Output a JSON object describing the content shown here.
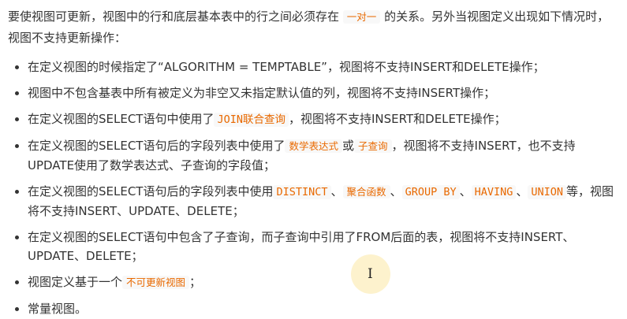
{
  "intro": {
    "text1": "要使视图可更新，视图中的行和底层基本表中的行之间必须存在",
    "code1": "一对一",
    "text2": "的关系。另外当视图定义出现如下情况时，视图不支持更新操作："
  },
  "items": [
    {
      "parts": [
        {
          "t": "在定义视图的时候指定了“ALGORITHM = TEMPTABLE”，视图将不支持INSERT和DELETE操作；"
        }
      ]
    },
    {
      "parts": [
        {
          "t": "视图中不包含基表中所有被定义为非空又未指定默认值的列，视图将不支持INSERT操作；"
        }
      ]
    },
    {
      "parts": [
        {
          "t": "在定义视图的SELECT语句中使用了"
        },
        {
          "code": "JOIN联合查询"
        },
        {
          "t": "，视图将不支持INSERT和DELETE操作；"
        }
      ]
    },
    {
      "parts": [
        {
          "t": "在定义视图的SELECT语句后的字段列表中使用了"
        },
        {
          "code": "数学表达式",
          "light": true
        },
        {
          "t": "或"
        },
        {
          "code": "子查询",
          "light": true
        },
        {
          "t": "，视图将不支持INSERT，也不支持UPDATE使用了数学表达式、子查询的字段值；"
        }
      ]
    },
    {
      "parts": [
        {
          "t": "在定义视图的SELECT语句后的字段列表中使用"
        },
        {
          "code": "DISTINCT"
        },
        {
          "t": "、"
        },
        {
          "code": "聚合函数",
          "light": true
        },
        {
          "t": "、"
        },
        {
          "code": "GROUP BY"
        },
        {
          "t": "、"
        },
        {
          "code": "HAVING"
        },
        {
          "t": "、"
        },
        {
          "code": "UNION"
        },
        {
          "t": "等，视图将不支持INSERT、UPDATE、DELETE；"
        }
      ]
    },
    {
      "parts": [
        {
          "t": "在定义视图的SELECT语句中包含了子查询，而子查询中引用了FROM后面的表，视图将不支持INSERT、UPDATE、DELETE；"
        }
      ]
    },
    {
      "parts": [
        {
          "t": "视图定义基于一个"
        },
        {
          "code": "不可更新视图",
          "light": true
        },
        {
          "t": "；"
        }
      ]
    },
    {
      "parts": [
        {
          "t": "常量视图。"
        }
      ]
    }
  ],
  "cursor": "I"
}
